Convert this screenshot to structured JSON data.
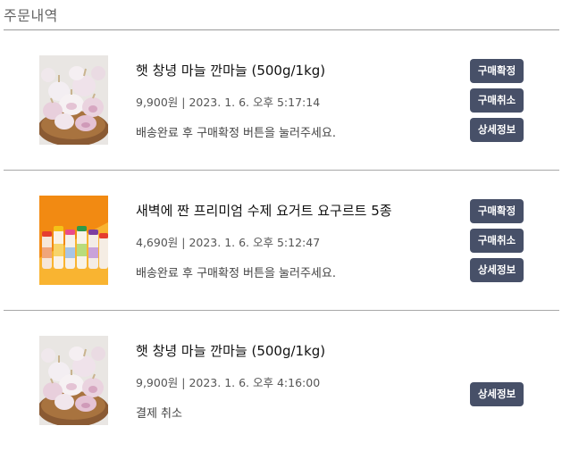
{
  "page": {
    "title": "주문내역"
  },
  "orders": [
    {
      "image": "garlic-basket-photo",
      "name": "햇 창녕 마늘 깐마늘 (500g/1kg)",
      "meta": "9,900원 | 2023. 1. 6. 오후 5:17:14",
      "status": "배송완료 후 구매확정 버튼을 눌러주세요.",
      "buttons": [
        "구매확정",
        "구매취소",
        "상세정보"
      ]
    },
    {
      "image": "yogurt-bottles-photo",
      "name": "새벽에 짠 프리미엄 수제 요거트 요구르트 5종",
      "meta": "4,690원 | 2023. 1. 6. 오후 5:12:47",
      "status": "배송완료 후 구매확정 버튼을 눌러주세요.",
      "buttons": [
        "구매확정",
        "구매취소",
        "상세정보"
      ]
    },
    {
      "image": "garlic-basket-photo",
      "name": "햇 창녕 마늘 깐마늘 (500g/1kg)",
      "meta": "9,900원 | 2023. 1. 6. 오후 4:16:00",
      "status": "결제 취소",
      "buttons": [
        "상세정보"
      ]
    }
  ],
  "colors": {
    "button_bg": "#475068",
    "button_text": "#ffffff",
    "divider": "#a8a8a8"
  }
}
